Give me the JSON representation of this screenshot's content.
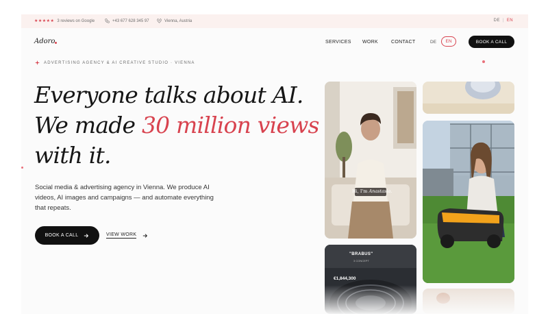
{
  "topbar": {
    "stars": "★★★★★",
    "reviews": "3 reviews on Google",
    "phone": "+43 677 628 345 97",
    "location": "Vienna, Austria",
    "lang_de": "DE",
    "lang_sep": "|",
    "lang_en": "EN"
  },
  "brand": {
    "logo": "Adoro"
  },
  "nav": {
    "services": "SERVICES",
    "work": "WORK",
    "contact": "CONTACT",
    "lang_de": "DE",
    "lang_en": "EN",
    "cta": "BOOK A CALL"
  },
  "hero": {
    "eyebrow": "ADVERTISING AGENCY & AI CREATIVE STUDIO · VIENNA",
    "headline_line1": "Everyone talks about AI.",
    "headline_line2_prefix": "We made ",
    "headline_line2_accent": "30 million views",
    "headline_line3": "with it.",
    "lead_line1": "Social media & advertising agency in Vienna. We produce AI",
    "lead_line2": "videos, AI images and campaigns — and automate everything",
    "lead_line3": "that repeats.",
    "primary_button": "BOOK A CALL",
    "secondary_button": "VIEW WORK"
  },
  "media": {
    "card_a_caption_prefix": "Hi, I'm ",
    "card_a_caption_name": "Anastasia.",
    "card_d_title": "\"BRABUS\"",
    "card_d_sub": "3 CONCEPT",
    "card_d_price": "€1,844,300"
  },
  "colors": {
    "accent": "#d8434f",
    "topbar_bg": "#fbf1ef",
    "dark_button": "#111111"
  },
  "icons": {
    "phone": "phone-icon",
    "location": "pin-icon",
    "eyebrow": "sparkle-icon",
    "arrow": "arrow-right-icon"
  }
}
